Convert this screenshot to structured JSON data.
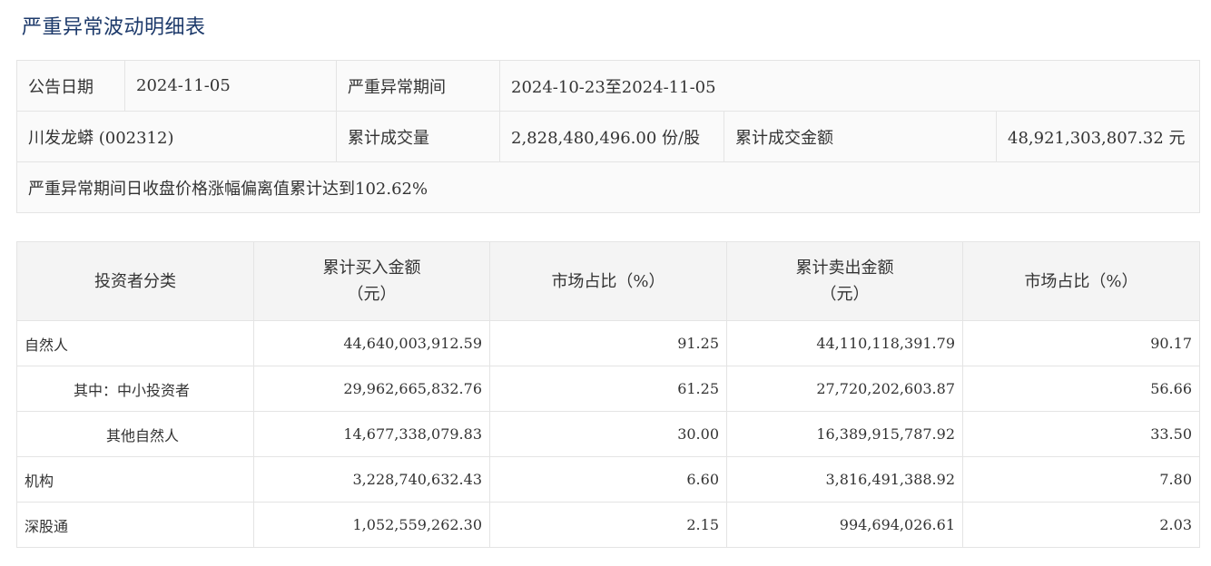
{
  "title": "严重异常波动明细表",
  "summary": {
    "announce_date_label": "公告日期",
    "announce_date": "2024-11-05",
    "period_label": "严重异常期间",
    "period": "2024-10-23至2024-11-05",
    "stock_name": "川发龙蟒 (002312)",
    "volume_label": "累计成交量",
    "volume": "2,828,480,496.00 份/股",
    "amount_label": "累计成交金额",
    "amount": "48,921,303,807.32 元",
    "deviation_note": "严重异常期间日收盘价格涨幅偏离值累计达到102.62%"
  },
  "detail": {
    "headers": {
      "category": "投资者分类",
      "buy_amount_1": "累计买入金额",
      "buy_amount_2": "（元）",
      "buy_share": "市场占比（%）",
      "sell_amount_1": "累计卖出金额",
      "sell_amount_2": "（元）",
      "sell_share": "市场占比（%）"
    },
    "rows": [
      {
        "category": "自然人",
        "buy": "44,640,003,912.59",
        "buy_pct": "91.25",
        "sell": "44,110,118,391.79",
        "sell_pct": "90.17"
      },
      {
        "category": "其中：中小投资者",
        "buy": "29,962,665,832.76",
        "buy_pct": "61.25",
        "sell": "27,720,202,603.87",
        "sell_pct": "56.66"
      },
      {
        "category": "其他自然人",
        "buy": "14,677,338,079.83",
        "buy_pct": "30.00",
        "sell": "16,389,915,787.92",
        "sell_pct": "33.50"
      },
      {
        "category": "机构",
        "buy": "3,228,740,632.43",
        "buy_pct": "6.60",
        "sell": "3,816,491,388.92",
        "sell_pct": "7.80"
      },
      {
        "category": "深股通",
        "buy": "1,052,559,262.30",
        "buy_pct": "2.15",
        "sell": "994,694,026.61",
        "sell_pct": "2.03"
      }
    ]
  }
}
